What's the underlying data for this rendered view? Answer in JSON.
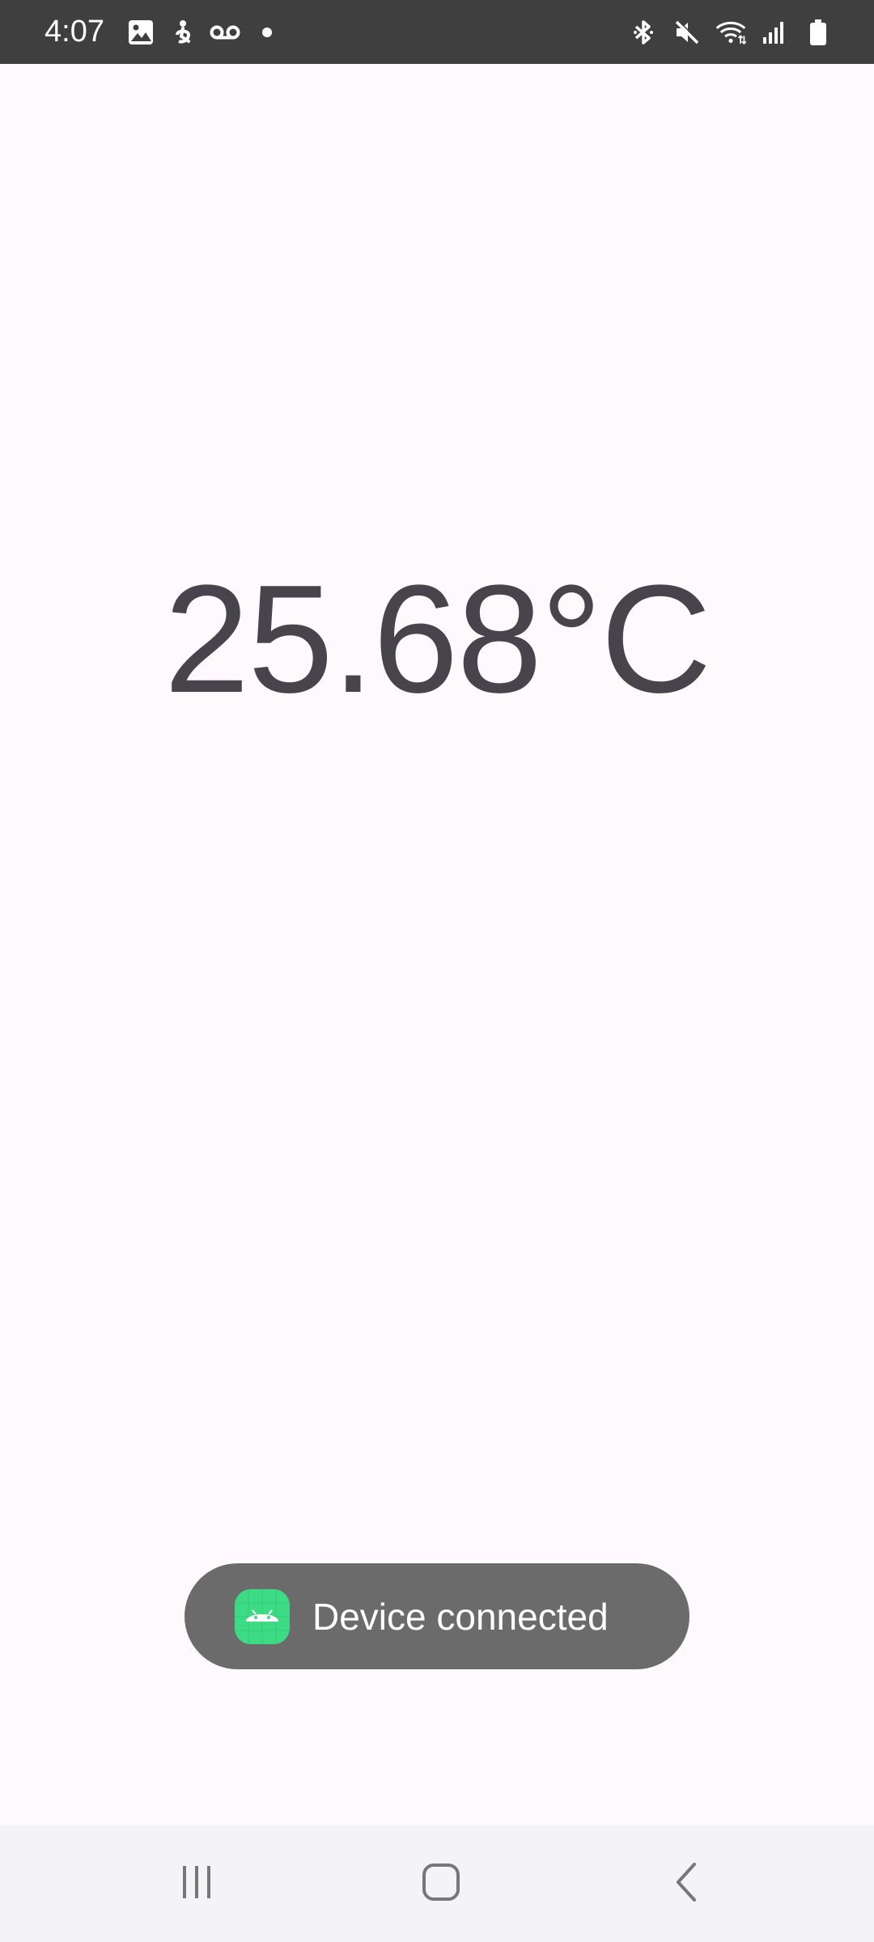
{
  "status_bar": {
    "time": "4:07",
    "left_icons": [
      "gallery-icon",
      "accessibility-icon",
      "voicemail-icon",
      "notification-dot-icon"
    ],
    "right_icons": [
      "bluetooth-icon",
      "mute-icon",
      "wifi-icon",
      "signal-icon",
      "battery-icon"
    ]
  },
  "main": {
    "temperature": "25.68°C"
  },
  "toast": {
    "icon": "android-app-icon",
    "message": "Device connected"
  },
  "nav_bar": {
    "buttons": [
      "recent-apps-button",
      "home-button",
      "back-button"
    ]
  },
  "colors": {
    "background": "#FEF9FD",
    "status_bar": "#3F3F3F",
    "temperature_text": "#47444C",
    "toast_bg": "#6B6B6B",
    "android_green": "#3DDC84",
    "nav_bar": "#F4F4F6"
  }
}
